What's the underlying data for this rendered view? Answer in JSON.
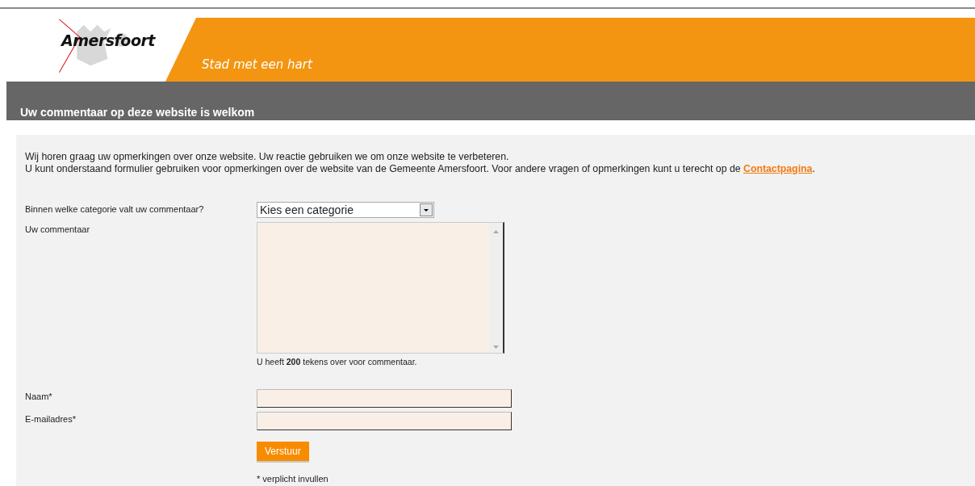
{
  "header": {
    "logo": "Amersfoort",
    "slogan": "Stad met een hart"
  },
  "title": "Uw commentaar op deze website is welkom",
  "intro": {
    "line_1": "Wij horen graag uw opmerkingen over onze website. Uw reactie gebruiken we om onze website te verbeteren.",
    "line_2": "U kunt onderstaand formulier gebruiken voor opmerkingen over de website van de Gemeente Amersfoort. Voor andere vragen of opmerkingen kunt u terecht op de ",
    "link": "Contactpagina",
    "line_2_end": "."
  },
  "form": {
    "category": {
      "label": "Binnen welke categorie valt uw commentaar?",
      "value": "Kies een categorie"
    },
    "comment": {
      "label": "Uw commentaar",
      "counter": "U heeft **200** tekens over voor commentaar."
    },
    "fields": [
      {
        "label": "Naam*"
      },
      {
        "label": "E-mailadres*"
      }
    ],
    "submit": "Verstuur",
    "note": "* verplicht invullen"
  }
}
